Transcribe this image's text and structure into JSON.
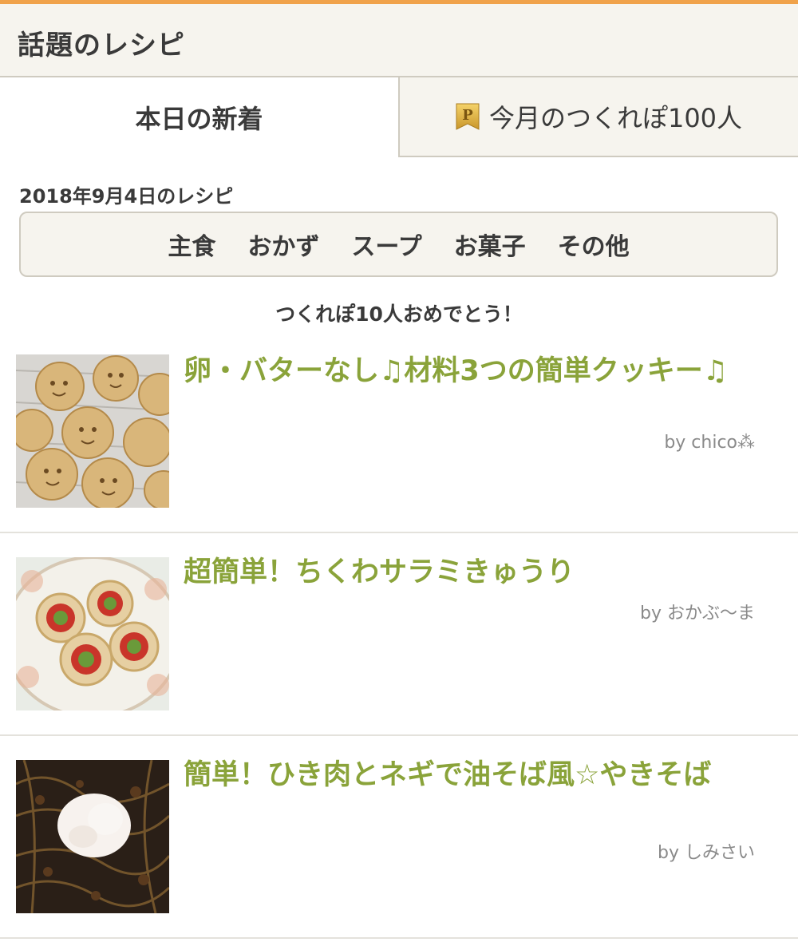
{
  "header": {
    "title": "話題のレシピ"
  },
  "tabs": [
    {
      "label": "本日の新着",
      "active": true
    },
    {
      "label": "今月のつくれぽ100人",
      "active": false,
      "icon": "p-badge-icon"
    }
  ],
  "date_heading": "2018年9月4日のレシピ",
  "categories": [
    "主食",
    "おかず",
    "スープ",
    "お菓子",
    "その他"
  ],
  "congrats": "つくれぽ10人おめでとう！",
  "recipes": [
    {
      "title": "卵・バターなし♫材料3つの簡単クッキー♫",
      "author": "by chico⁂",
      "image": "smiley-cookies-photo"
    },
    {
      "title": "超簡単！ちくわサラミきゅうり",
      "author": "by おかぶ〜ま",
      "image": "chikuwa-rolls-photo"
    },
    {
      "title": "簡単！ひき肉とネギで油そば風☆やきそば",
      "author": "by しみさい",
      "image": "yakisoba-egg-photo"
    }
  ],
  "colors": {
    "accent": "#f0a24a",
    "recipe_title": "#8aa33a",
    "header_bg": "#f6f4ee"
  }
}
